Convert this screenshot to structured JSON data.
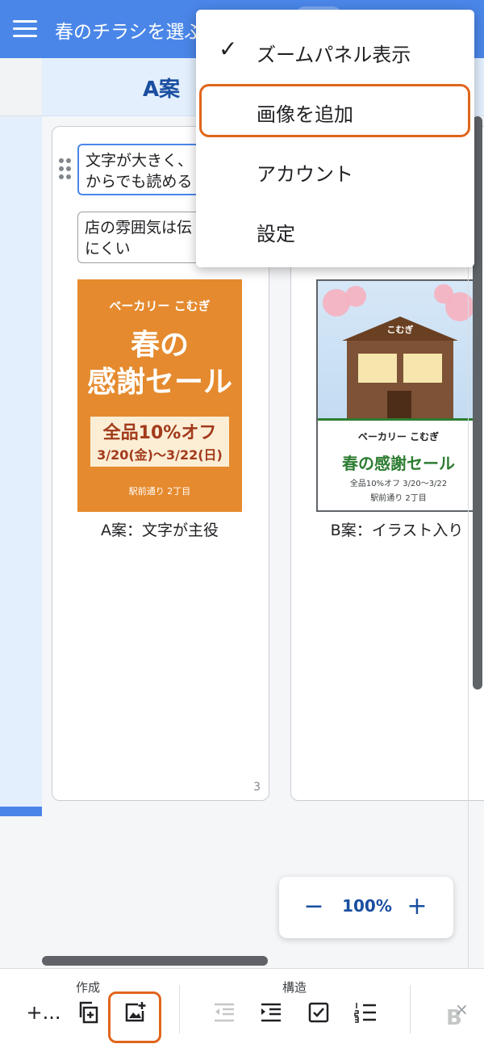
{
  "appbar": {
    "title": "春のチラシを選ぶ"
  },
  "columns": {
    "a_header": "A案"
  },
  "card_a": {
    "notes": [
      "文字が大きく、\nからでも読める",
      "店の雰囲気は伝\nにくい"
    ],
    "caption": "A案：文字が主役",
    "page_number": "3"
  },
  "flyer_a": {
    "shop": "ベーカリー こむぎ",
    "line1": "春の",
    "line2": "感謝セール",
    "sale": "全品10%オフ",
    "dates": "3/20(金)〜3/22(日)",
    "address": "駅前通り 2丁目",
    "bg_color": "#e58a2e"
  },
  "card_b": {
    "caption": "B案：イラスト入り"
  },
  "flyer_b": {
    "sign": "こむぎ",
    "shop": "ベーカリー こむぎ",
    "title": "春の感謝セール",
    "sub": "全品10%オフ  3/20〜3/22",
    "address": "駅前通り 2丁目",
    "title_color": "#2e7d32"
  },
  "zoom": {
    "minus": "−",
    "value": "100%",
    "plus": "+"
  },
  "toolbar": {
    "group_create": "作成",
    "group_structure": "構造",
    "add_label": "+...",
    "bold_label": "B",
    "close_label": "×"
  },
  "menu": {
    "items": [
      {
        "label": "ズームパネル表示",
        "checked": true
      },
      {
        "label": "画像を追加",
        "highlighted": true
      },
      {
        "label": "アカウント"
      },
      {
        "label": "設定"
      }
    ],
    "check_glyph": "✓"
  },
  "colors": {
    "accent": "#4a86e8",
    "highlight": "#e0651c",
    "primary_text": "#1a4ea0"
  }
}
